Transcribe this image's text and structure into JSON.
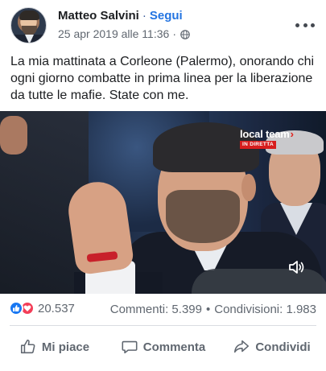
{
  "post": {
    "author": "Matteo Salvini",
    "follow_label": "Segui",
    "timestamp": "25 apr 2019 alle 11:36",
    "privacy_icon": "globe-icon",
    "text": "La mia mattinata a Corleone (Palermo), onorando chi ogni giorno combatte in prima linea per la liberazione da tutte le mafie. State con me."
  },
  "video": {
    "channel_logo": "local team",
    "live_badge": "IN DIRETTA",
    "sound_icon": "speaker-icon"
  },
  "stats": {
    "reactions_count": "20.537",
    "comments": "Commenti: 5.399",
    "shares": "Condivisioni: 1.983",
    "reaction_icons": [
      "like-icon",
      "love-icon"
    ]
  },
  "actions": {
    "like": "Mi piace",
    "comment": "Commenta",
    "share": "Condividi"
  },
  "colors": {
    "facebook_blue": "#1877f2",
    "love_red": "#f33e58",
    "follow_blue": "#2374e1",
    "secondary_text": "#606770"
  }
}
